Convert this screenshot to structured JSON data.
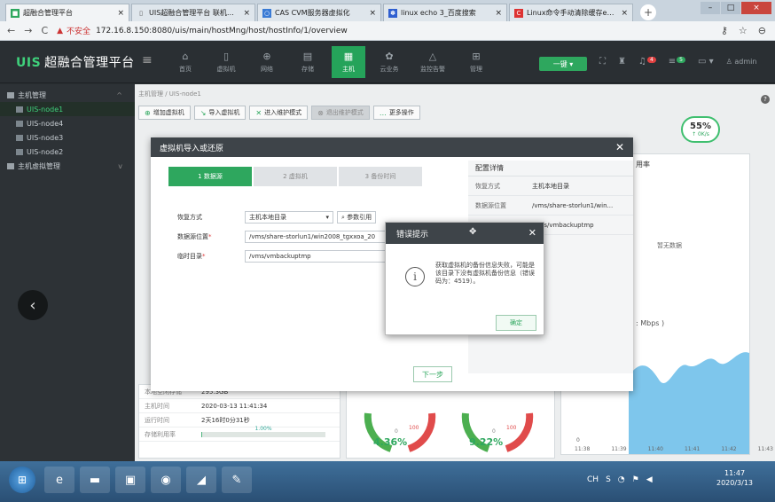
{
  "browser": {
    "tabs": [
      {
        "favicon": "uis-icon",
        "label": "超融合管理平台",
        "active": true
      },
      {
        "favicon": "page-icon",
        "label": "UIS超融合管理平台 联机帮助",
        "active": false
      },
      {
        "favicon": "cas-icon",
        "label": "CAS CVM服务器虚拟化",
        "active": false
      },
      {
        "favicon": "paw-icon",
        "label": "linux echo 3_百度搜索",
        "active": false
      },
      {
        "favicon": "c-icon",
        "label": "Linux命令手动清除缓存echo 3",
        "active": false
      }
    ],
    "new_tab": "+",
    "insecure_label": "不安全",
    "url": "172.16.8.150:8080/uis/main/hostMng/host/hostInfo/1/overview"
  },
  "header": {
    "brand_logo": "UIS",
    "brand_title": "超融合管理平台",
    "nav": [
      {
        "label": "首页",
        "icon": "home-icon",
        "active": false
      },
      {
        "label": "虚拟机",
        "icon": "vm-icon",
        "active": false
      },
      {
        "label": "网络",
        "icon": "network-icon",
        "active": false
      },
      {
        "label": "存储",
        "icon": "storage-icon",
        "active": false
      },
      {
        "label": "主机",
        "icon": "host-icon",
        "active": true
      },
      {
        "label": "云业务",
        "icon": "cloud-icon",
        "active": false
      },
      {
        "label": "监控告警",
        "icon": "alarm-icon",
        "active": false
      },
      {
        "label": "管理",
        "icon": "manage-icon",
        "active": false
      }
    ],
    "quick_label": "一键",
    "alert_badge": "4",
    "msg_badge": "5",
    "user_label": "admin"
  },
  "sidebar": {
    "group1": "主机管理",
    "nodes": [
      "UIS-node1",
      "UIS-node4",
      "UIS-node3",
      "UIS-node2"
    ],
    "selected": "UIS-node1",
    "group2": "主机虚拟管理"
  },
  "main": {
    "breadcrumb": "主机管理 / UIS-node1",
    "toolbar": [
      "增加虚拟机",
      "导入虚拟机",
      "进入维护模式",
      "退出维护模式",
      "更多操作"
    ],
    "gauge_value": "55%",
    "gauge_speed": "↑ 0K/s",
    "right_title": "用率",
    "nodata": "暂无数据",
    "mbps": ": Mbps )",
    "x_ticks": [
      "11:38",
      "11:39",
      "11:40",
      "11:41",
      "11:42",
      "11:43"
    ],
    "y0": "0",
    "info": [
      {
        "k": "本地空闲存储",
        "v": "295.3GB"
      },
      {
        "k": "主机时间",
        "v": "2020-03-13 11:41:34"
      },
      {
        "k": "运行时间",
        "v": "2天16时0分31秒"
      },
      {
        "k": "存储利用率",
        "v": "1.00%"
      }
    ],
    "storage_pct": 1.0,
    "gauge1": "4.36%",
    "gauge2": "9.22%",
    "gauge_max": "100",
    "gauge_min": "0"
  },
  "dialog": {
    "title": "虚拟机导入或还原",
    "steps": [
      "1 数据源",
      "2 虚拟机",
      "3 备份时间"
    ],
    "form": {
      "restore_label": "恢复方式",
      "restore_value": "主机本地目录",
      "ref_btn": "参数引用",
      "src_label": "数据源位置",
      "src_value": "/vms/share-storlun1/win2008_tgxxoa_20",
      "tmp_label": "临时目录",
      "tmp_value": "/vms/vmbackuptmp"
    },
    "config": {
      "title": "配置详情",
      "rows": [
        {
          "k": "恢复方式",
          "v": "主机本地目录"
        },
        {
          "k": "数据源位置",
          "v": "/vms/share-storlun1/win..."
        },
        {
          "k": "",
          "v": "/vms/vmbackuptmp"
        }
      ]
    },
    "next": "下一步"
  },
  "error": {
    "title": "错误提示",
    "message": "获取虚拟机的备份信息失败，可能是该目录下没有虚拟机备份信息（错误码为：4519）。",
    "ok": "确定"
  },
  "taskbar": {
    "time": "11:47",
    "date": "2020/3/13"
  },
  "colors": {
    "accent": "#2ea75e",
    "header_bg": "#2a2f33",
    "error": "#e04040"
  }
}
